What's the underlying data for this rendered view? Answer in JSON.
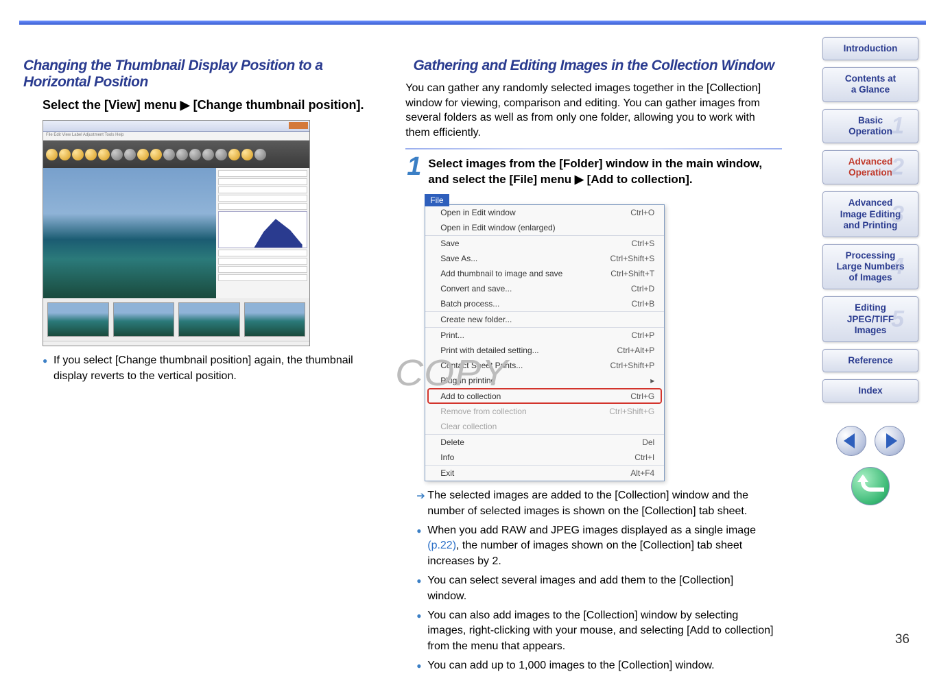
{
  "left": {
    "title": "Changing the Thumbnail Display Position to a Horizontal Position",
    "instruction": "Select the [View] menu ▶ [Change thumbnail position].",
    "note1": "If you select [Change thumbnail position] again, the thumbnail display reverts to the vertical position."
  },
  "right": {
    "title": "Gathering and Editing Images in the Collection Window",
    "intro": "You can gather any randomly selected images together in the [Collection] window for viewing, comparison and editing. You can gather images from several folders as well as from only one folder, allowing you to work with them efficiently.",
    "step_num": "1",
    "step_text": "Select images from the [Folder] window in the main window, and select the [File] menu ▶ [Add to collection].",
    "menu_tab": "File",
    "menu_groups": [
      [
        {
          "label": "Open in Edit window",
          "kb": "Ctrl+O"
        },
        {
          "label": "Open in Edit window (enlarged)",
          "kb": ""
        }
      ],
      [
        {
          "label": "Save",
          "kb": "Ctrl+S"
        },
        {
          "label": "Save As...",
          "kb": "Ctrl+Shift+S"
        },
        {
          "label": "Add thumbnail to image and save",
          "kb": "Ctrl+Shift+T"
        },
        {
          "label": "Convert and save...",
          "kb": "Ctrl+D"
        },
        {
          "label": "Batch process...",
          "kb": "Ctrl+B"
        }
      ],
      [
        {
          "label": "Create new folder...",
          "kb": ""
        }
      ],
      [
        {
          "label": "Print...",
          "kb": "Ctrl+P"
        },
        {
          "label": "Print with detailed setting...",
          "kb": "Ctrl+Alt+P"
        },
        {
          "label": "Contact Sheet Prints...",
          "kb": "Ctrl+Shift+P"
        },
        {
          "label": "Plug-in printing",
          "kb": "",
          "sub": true
        }
      ],
      [
        {
          "label": "Add to collection",
          "kb": "Ctrl+G",
          "highlight": true
        },
        {
          "label": "Remove from collection",
          "kb": "Ctrl+Shift+G",
          "disabled": true
        },
        {
          "label": "Clear collection",
          "kb": "",
          "disabled": true
        }
      ],
      [
        {
          "label": "Delete",
          "kb": "Del"
        },
        {
          "label": "Info",
          "kb": "Ctrl+I"
        }
      ],
      [
        {
          "label": "Exit",
          "kb": "Alt+F4"
        }
      ]
    ],
    "result": "The selected images are added to the [Collection] window and the number of selected images is shown on the [Collection] tab sheet.",
    "bullet1a": "When you add RAW and JPEG images displayed as a single image ",
    "bullet1_link": "(p.22)",
    "bullet1b": ", the number of images shown on the [Collection] tab sheet increases by 2.",
    "bullet2": "You can select several images and add them to the [Collection] window.",
    "bullet3": "You can also add images to the [Collection] window by selecting images, right-clicking with your mouse, and selecting [Add to collection] from the menu that appears.",
    "bullet4": "You can add up to 1,000 images to the [Collection] window."
  },
  "sidebar": [
    {
      "label": "Introduction"
    },
    {
      "label": "Contents at a Glance"
    },
    {
      "label": "Basic Operation",
      "num": "1"
    },
    {
      "label": "Advanced Operation",
      "num": "2",
      "red": true
    },
    {
      "label": "Advanced Image Editing and Printing",
      "num": "3"
    },
    {
      "label": "Processing Large Numbers of Images",
      "num": "4"
    },
    {
      "label": "Editing JPEG/TIFF Images",
      "num": "5"
    },
    {
      "label": "Reference"
    },
    {
      "label": "Index"
    }
  ],
  "page_number": "36",
  "watermark": "COPY"
}
